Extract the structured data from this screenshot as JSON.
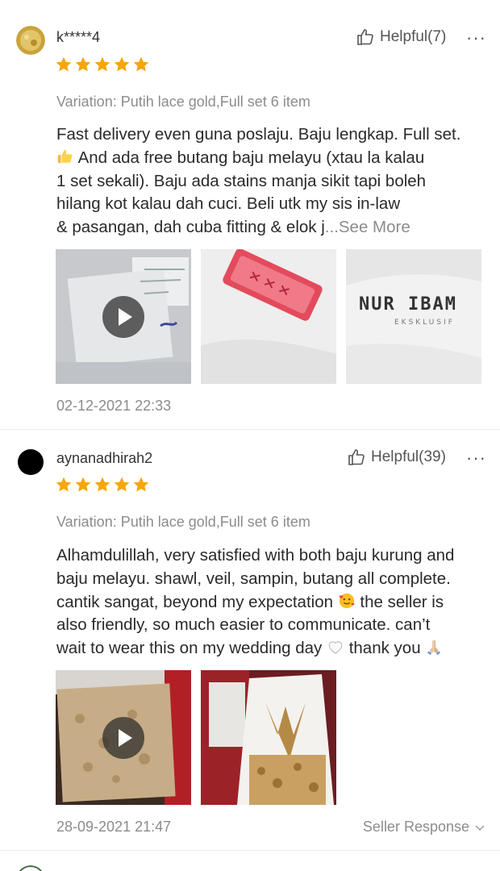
{
  "reviews": [
    {
      "username": "k*****4",
      "helpful_label": "Helpful(7)",
      "rating": 5,
      "variation": "Variation: Putih lace gold,Full set 6 item",
      "body_lines": [
        "Fast delivery even guna poslaju. Baju lengkap. Full set.",
        " And ada free butang baju melayu (xtau la kalau",
        "1 set sekali). Baju ada stains manja sikit tapi boleh",
        "hilang kot kalau dah cuci. Beli utk my sis in-law",
        " & pasangan, dah cuba fitting & elok j"
      ],
      "see_more": "...See More",
      "date": "02-12-2021 22:33",
      "media_text": "NUR IBAM",
      "media_subtext": "EKSKLUSIF"
    },
    {
      "username": "aynanadhirah2",
      "helpful_label": "Helpful(39)",
      "rating": 5,
      "variation": "Variation: Putih lace gold,Full set 6 item",
      "body_lines": [
        "Alhamdulillah, very satisfied with both baju kurung and",
        "baju melayu. shawl, veil, sampin, butang all complete.",
        "cantik sangat, beyond my expectation ",
        " the seller is",
        "also friendly, so much easier to communicate. can’t",
        "wait to wear this on my wedding day ",
        " thank you "
      ],
      "date": "28-09-2021 21:47",
      "seller_response": "Seller Response"
    }
  ],
  "icons": {
    "thumbs_up": "thumbs-up-icon",
    "more": "more-dots-icon",
    "star": "star-icon",
    "play": "play-icon",
    "chevron": "chevron-down-icon"
  },
  "colors": {
    "star": "#f6a609",
    "muted": "#8c8c8c",
    "text": "#2a2a2a"
  }
}
